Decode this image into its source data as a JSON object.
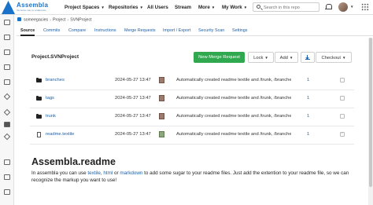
{
  "brand": {
    "name": "Assembla",
    "tagline": "the better way to collaborate"
  },
  "nav": [
    {
      "label": "Project Spaces",
      "has_caret": true
    },
    {
      "label": "Repositories",
      "has_caret": true
    },
    {
      "label": "All Users",
      "has_caret": false
    },
    {
      "label": "Stream",
      "has_caret": false
    },
    {
      "label": "More",
      "has_caret": true
    },
    {
      "label": "My Work",
      "has_caret": true
    }
  ],
  "search": {
    "placeholder": "Search in this repo"
  },
  "breadcrumb": [
    "someegacies",
    "Project",
    "SVNProject"
  ],
  "tabs": [
    {
      "label": "Source",
      "active": true
    },
    {
      "label": "Commits"
    },
    {
      "label": "Compare"
    },
    {
      "label": "Instructions"
    },
    {
      "label": "Merge Requests"
    },
    {
      "label": "Import / Export"
    },
    {
      "label": "Security Scan"
    },
    {
      "label": "Settings"
    }
  ],
  "repo": {
    "title": "Project.SVNProject",
    "new_merge_request": "New Merge Request",
    "lock": "Lock",
    "add": "Add",
    "checkout": "Checkout"
  },
  "files": [
    {
      "name": "branches",
      "type": "folder",
      "date": "2024-05-27 13:47",
      "message": "Automatically created readme textile and /trunk, /branches, /ta...",
      "rev": "1",
      "checked": false
    },
    {
      "name": "tags",
      "type": "folder",
      "date": "2024-05-27 13:47",
      "message": "Automatically created readme textile and /trunk, /branches, /ta...",
      "rev": "1",
      "checked": false
    },
    {
      "name": "trunk",
      "type": "folder",
      "date": "2024-05-27 13:47",
      "message": "Automatically created readme textile and /trunk, /branches, /ta...",
      "rev": "1",
      "checked": false
    },
    {
      "name": "readme.textile",
      "type": "file",
      "date": "2024-05-27 13:47",
      "message": "Automatically created readme textile and /trunk, /branches, /ta...",
      "rev": "1",
      "checked": true
    }
  ],
  "readme": {
    "title": "Assembla.readme",
    "text_1": "In assembla you can use ",
    "link_textile": "textile",
    "sep_1": ", ",
    "link_html": "html",
    "sep_2": " or ",
    "link_markdown": "markdown",
    "text_2": " to add some sugar to your readme files. Just add the extention to your readme file, so we can recognize the markup you want to use!"
  },
  "colors": {
    "accent": "#1a73c9",
    "primary_button": "#2fa84f",
    "link": "#1a5fa8"
  },
  "icons": {
    "search": "search-icon",
    "notifications": "bell-icon",
    "apps": "grid-icon"
  }
}
